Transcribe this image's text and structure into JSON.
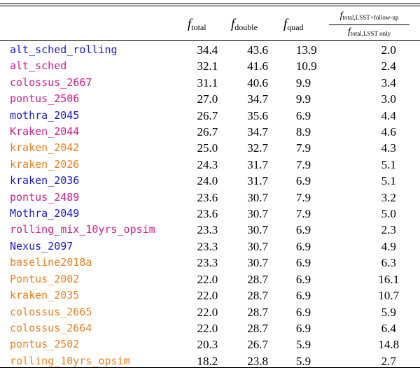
{
  "colors": {
    "blue": "#1a1acc",
    "magenta": "#d11d8c",
    "orange": "#f07f1e"
  },
  "header": {
    "total": {
      "f": "f",
      "sub": "total"
    },
    "double": {
      "f": "f",
      "sub": "double"
    },
    "quad": {
      "f": "f",
      "sub": "quad"
    },
    "ratio": {
      "num_f": "f",
      "num_sub": "total,LSST+follow-up",
      "den_f": "f",
      "den_sub": "total,LSST only"
    }
  },
  "rows": [
    {
      "name": "alt_sched_rolling",
      "color": "blue",
      "total": "34.4",
      "double": "43.6",
      "quad": "13.9",
      "ratio": "2.0"
    },
    {
      "name": "alt_sched",
      "color": "magenta",
      "total": "32.1",
      "double": "41.6",
      "quad": "10.9",
      "ratio": "2.4"
    },
    {
      "name": "colossus_2667",
      "color": "magenta",
      "total": "31.1",
      "double": "40.6",
      "quad": "9.9",
      "ratio": "3.4"
    },
    {
      "name": "pontus_2506",
      "color": "magenta",
      "total": "27.0",
      "double": "34.7",
      "quad": "9.9",
      "ratio": "3.0"
    },
    {
      "name": "mothra_2045",
      "color": "blue",
      "total": "26.7",
      "double": "35.6",
      "quad": "6.9",
      "ratio": "4.4"
    },
    {
      "name": "Kraken_2044",
      "color": "magenta",
      "total": "26.7",
      "double": "34.7",
      "quad": "8.9",
      "ratio": "4.6"
    },
    {
      "name": "kraken_2042",
      "color": "orange",
      "total": "25.0",
      "double": "32.7",
      "quad": "7.9",
      "ratio": "4.3"
    },
    {
      "name": "kraken_2026",
      "color": "orange",
      "total": "24.3",
      "double": "31.7",
      "quad": "7.9",
      "ratio": "5.1"
    },
    {
      "name": "kraken_2036",
      "color": "blue",
      "total": "24.0",
      "double": "31.7",
      "quad": "6.9",
      "ratio": "5.1"
    },
    {
      "name": "pontus_2489",
      "color": "magenta",
      "total": "23.6",
      "double": "30.7",
      "quad": "7.9",
      "ratio": "3.2"
    },
    {
      "name": "Mothra_2049",
      "color": "blue",
      "total": "23.6",
      "double": "30.7",
      "quad": "7.9",
      "ratio": "5.0"
    },
    {
      "name": "rolling_mix_10yrs_opsim",
      "color": "magenta",
      "total": "23.3",
      "double": "30.7",
      "quad": "6.9",
      "ratio": "2.3"
    },
    {
      "name": "Nexus_2097",
      "color": "blue",
      "total": "23.3",
      "double": "30.7",
      "quad": "6.9",
      "ratio": "4.9"
    },
    {
      "name": "baseline2018a",
      "color": "orange",
      "total": "23.3",
      "double": "30.7",
      "quad": "6.9",
      "ratio": "6.3"
    },
    {
      "name": "Pontus_2002",
      "color": "orange",
      "total": "22.0",
      "double": "28.7",
      "quad": "6.9",
      "ratio": "16.1"
    },
    {
      "name": "kraken_2035",
      "color": "orange",
      "total": "22.0",
      "double": "28.7",
      "quad": "6.9",
      "ratio": "10.7"
    },
    {
      "name": "colossus_2665",
      "color": "orange",
      "total": "22.0",
      "double": "28.7",
      "quad": "6.9",
      "ratio": "5.9"
    },
    {
      "name": "colossus_2664",
      "color": "orange",
      "total": "22.0",
      "double": "28.7",
      "quad": "6.9",
      "ratio": "6.4"
    },
    {
      "name": "pontus_2502",
      "color": "orange",
      "total": "20.3",
      "double": "26.7",
      "quad": "5.9",
      "ratio": "14.8"
    },
    {
      "name": "rolling_10yrs_opsim",
      "color": "orange",
      "total": "18.2",
      "double": "23.8",
      "quad": "5.9",
      "ratio": "2.7"
    }
  ]
}
